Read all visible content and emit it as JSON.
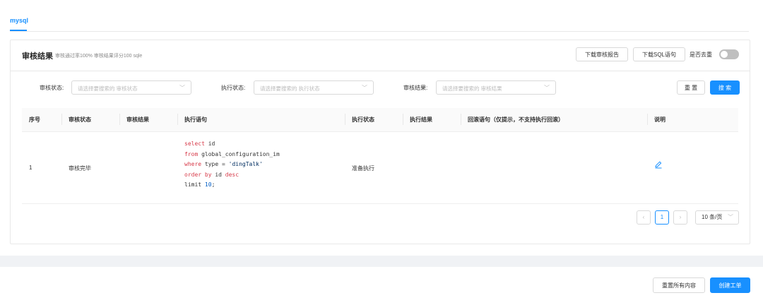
{
  "tabs": [
    {
      "label": "mysql"
    }
  ],
  "result_card": {
    "title": "审核结果",
    "subtitle": "审核通过率100%  审核结果评分100  sqle",
    "download_report_label": "下载审核报告",
    "download_sql_label": "下载SQL语句",
    "dedupe_label": "是否去重",
    "dedupe_enabled": false
  },
  "filters": {
    "audit_status": {
      "label": "审核状态:",
      "placeholder": "请选择要搜索的 审核状态"
    },
    "exec_status": {
      "label": "执行状态:",
      "placeholder": "请选择要搜索的 执行状态"
    },
    "audit_result": {
      "label": "审核结果:",
      "placeholder": "请选择要搜索的 审核结果"
    },
    "reset_label": "重 置",
    "search_label": "搜 索"
  },
  "table": {
    "columns": [
      "序号",
      "审核状态",
      "审核结果",
      "执行语句",
      "执行状态",
      "执行结果",
      "回滚语句（仅提示，不支持执行回滚）",
      "说明"
    ],
    "rows": [
      {
        "index": "1",
        "audit_status": "审核完毕",
        "audit_result": "",
        "sql_lines": [
          [
            {
              "t": "select",
              "c": "kw"
            },
            {
              "t": " id"
            }
          ],
          [
            {
              "t": "from",
              "c": "kw"
            },
            {
              "t": " global_configuration_im"
            }
          ],
          [
            {
              "t": "where",
              "c": "kw"
            },
            {
              "t": " type = "
            },
            {
              "t": "'dingTalk'",
              "c": "str"
            }
          ],
          [
            {
              "t": "order by",
              "c": "kw"
            },
            {
              "t": " id "
            },
            {
              "t": "desc",
              "c": "kw"
            }
          ],
          [
            {
              "t": "limit"
            },
            {
              "t": " "
            },
            {
              "t": "10",
              "c": "num"
            },
            {
              "t": ";"
            }
          ]
        ],
        "exec_status": "准备执行",
        "exec_result": "",
        "rollback": ""
      }
    ]
  },
  "pagination": {
    "prev": "‹",
    "current": "1",
    "next": "›",
    "page_size": "10 条/页"
  },
  "footer": {
    "reset_all_label": "重置所有内容",
    "create_label": "创建工单"
  },
  "colors": {
    "primary": "#1890ff"
  },
  "icons": {
    "dropdown": "chevron-down-icon",
    "edit": "edit-icon"
  }
}
